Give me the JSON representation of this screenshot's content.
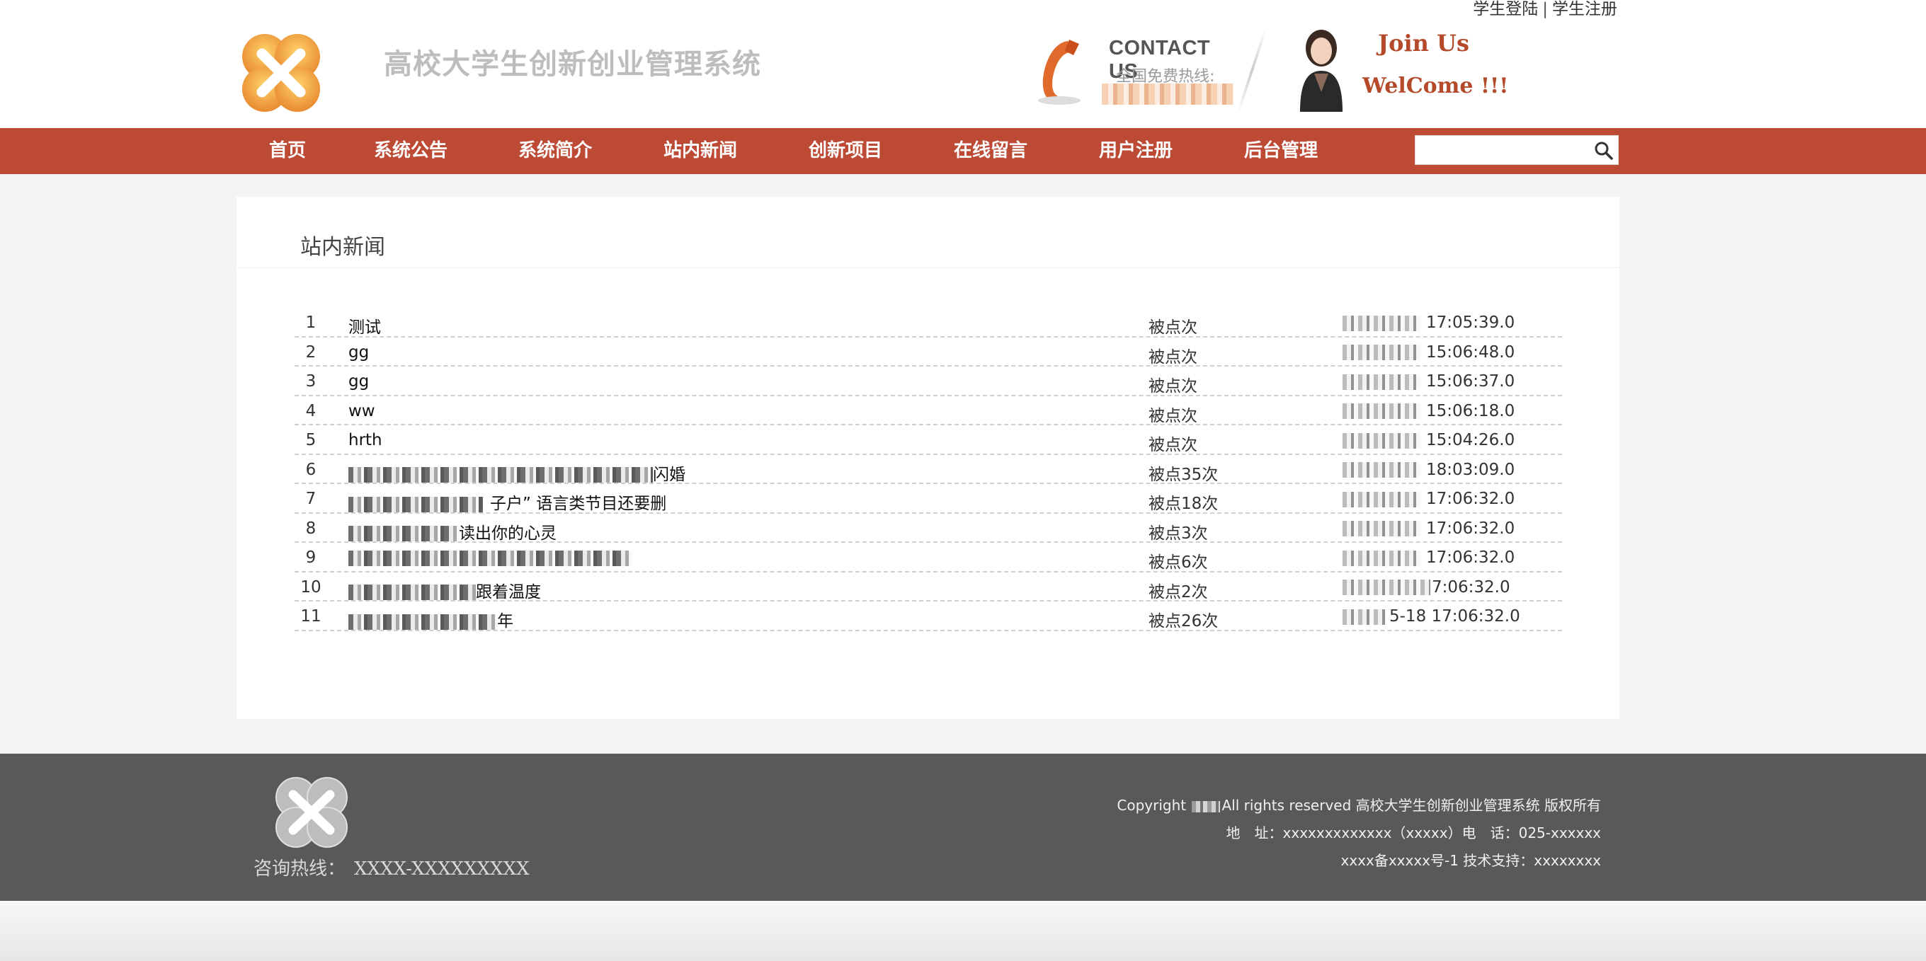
{
  "header": {
    "top_links": {
      "login": "学生登陆",
      "separator": "|",
      "register": "学生注册"
    },
    "site_title": "高校大学生创新创业管理系统",
    "contact_title": "CONTACT US",
    "hotline_label": "全国免费热线:",
    "join_us": "Join Us",
    "welcome": "WelCome !!!"
  },
  "nav": {
    "items": [
      "首页",
      "系统公告",
      "系统简介",
      "站内新闻",
      "创新项目",
      "在线留言",
      "用户注册",
      "后台管理"
    ],
    "search_placeholder": ""
  },
  "main": {
    "panel_title": "站内新闻",
    "news": [
      {
        "num": "1",
        "title": "测试",
        "clicks": "被点次",
        "date_suffix": "17:05:39.0"
      },
      {
        "num": "2",
        "title": "gg",
        "clicks": "被点次",
        "date_suffix": "15:06:48.0"
      },
      {
        "num": "3",
        "title": "gg",
        "clicks": "被点次",
        "date_suffix": "15:06:37.0"
      },
      {
        "num": "4",
        "title": "ww",
        "clicks": "被点次",
        "date_suffix": "15:06:18.0"
      },
      {
        "num": "5",
        "title": "hrth",
        "clicks": "被点次",
        "date_suffix": "15:04:26.0"
      },
      {
        "num": "6",
        "title": "闪婚",
        "clicks": "被点35次",
        "date_suffix": "18:03:09.0"
      },
      {
        "num": "7",
        "title": "子户” 语言类节目还要删",
        "clicks": "被点18次",
        "date_suffix": "17:06:32.0"
      },
      {
        "num": "8",
        "title": "读出你的心灵",
        "clicks": "被点3次",
        "date_suffix": "17:06:32.0"
      },
      {
        "num": "9",
        "title": "",
        "clicks": "被点6次",
        "date_suffix": "17:06:32.0"
      },
      {
        "num": "10",
        "title": "跟着温度",
        "clicks": "被点2次",
        "date_suffix": "7:06:32.0"
      },
      {
        "num": "11",
        "title": "年",
        "clicks": "被点26次",
        "date_suffix": "5-18 17:06:32.0"
      }
    ]
  },
  "footer": {
    "hotline_label": "咨询热线：",
    "hotline_value": "XXXX-XXXXXXXXX",
    "copyright_prefix": "Copyright",
    "copyright_suffix": "All rights reserved 高校大学生创新创业管理系统 版权所有",
    "address_line": "地　址：xxxxxxxxxxxxx（xxxxx）电　话：025-xxxxxx",
    "icp_line": "xxxx备xxxxx号-1 技术支持：xxxxxxxx"
  },
  "colors": {
    "nav_bg": "#bc4a35",
    "footer_bg": "#595959",
    "accent_orange": "#e8892f",
    "join_red": "#b44a2a"
  }
}
